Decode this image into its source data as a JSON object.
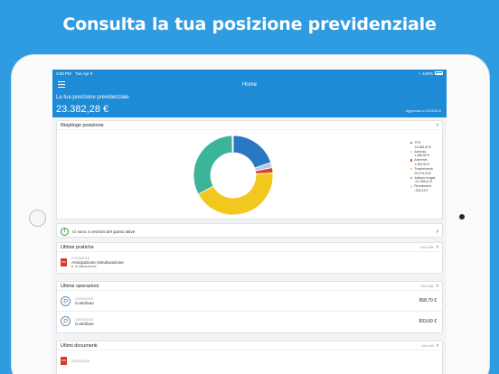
{
  "headline": "Consulta la tua posizione previdenziale",
  "status_bar": {
    "time": "3:56 PM",
    "date": "Tue Apr 9",
    "battery": "100%"
  },
  "nav": {
    "title": "Home"
  },
  "summary": {
    "label": "La tua posizione previdenziale",
    "amount": "23.382,28 €",
    "updated": "Aggiornato al 12/03/2019"
  },
  "riepilogo": {
    "title": "Riepilogo posizione",
    "chart_data": {
      "type": "pie",
      "style": "donut",
      "legend_position": "right",
      "series": [
        {
          "name": "TFR",
          "value": 13486.42,
          "label": "13.486,42 €",
          "color": "#2a77c4"
        },
        {
          "name": "Azienda",
          "value": 1466.59,
          "label": "1.466,59 €",
          "color": "#b7cce6"
        },
        {
          "name": "Aderente",
          "value": 1463.94,
          "label": "1.463,94 €",
          "color": "#d8432c"
        },
        {
          "name": "Trasferimenti",
          "value": 29274.23,
          "label": "29.274,23 €",
          "color": "#f2c81f"
        },
        {
          "name": "Anticipi erogati",
          "value": 22168.41,
          "label": "-22.168,41 €",
          "color": "#3cb49a"
        },
        {
          "name": "Rendimento",
          "value": 309.23,
          "label": "-309,23 €",
          "color": "#dddddd"
        }
      ]
    }
  },
  "quinto": {
    "text": "Ci sono 4 cessioni del quinto attive"
  },
  "pratiche": {
    "title": "Ultime pratiche",
    "more": "Vedi tutte",
    "items": [
      {
        "date": "07/03/2019",
        "title": "Anticipazione ristrutturazione",
        "state": "In elaborazione"
      }
    ]
  },
  "operazioni": {
    "title": "Ultime operazioni",
    "more": "Vedi tutte",
    "items": [
      {
        "date": "22/01/2019",
        "title": "Contributo",
        "amount": "958,70 €"
      },
      {
        "date": "19/01/2019",
        "title": "Contributo",
        "amount": "833,60 €"
      }
    ]
  },
  "documenti": {
    "title": "Ultimi documenti",
    "more": "Vedi tutti",
    "items": [
      {
        "date": "07/03/2019"
      }
    ]
  }
}
